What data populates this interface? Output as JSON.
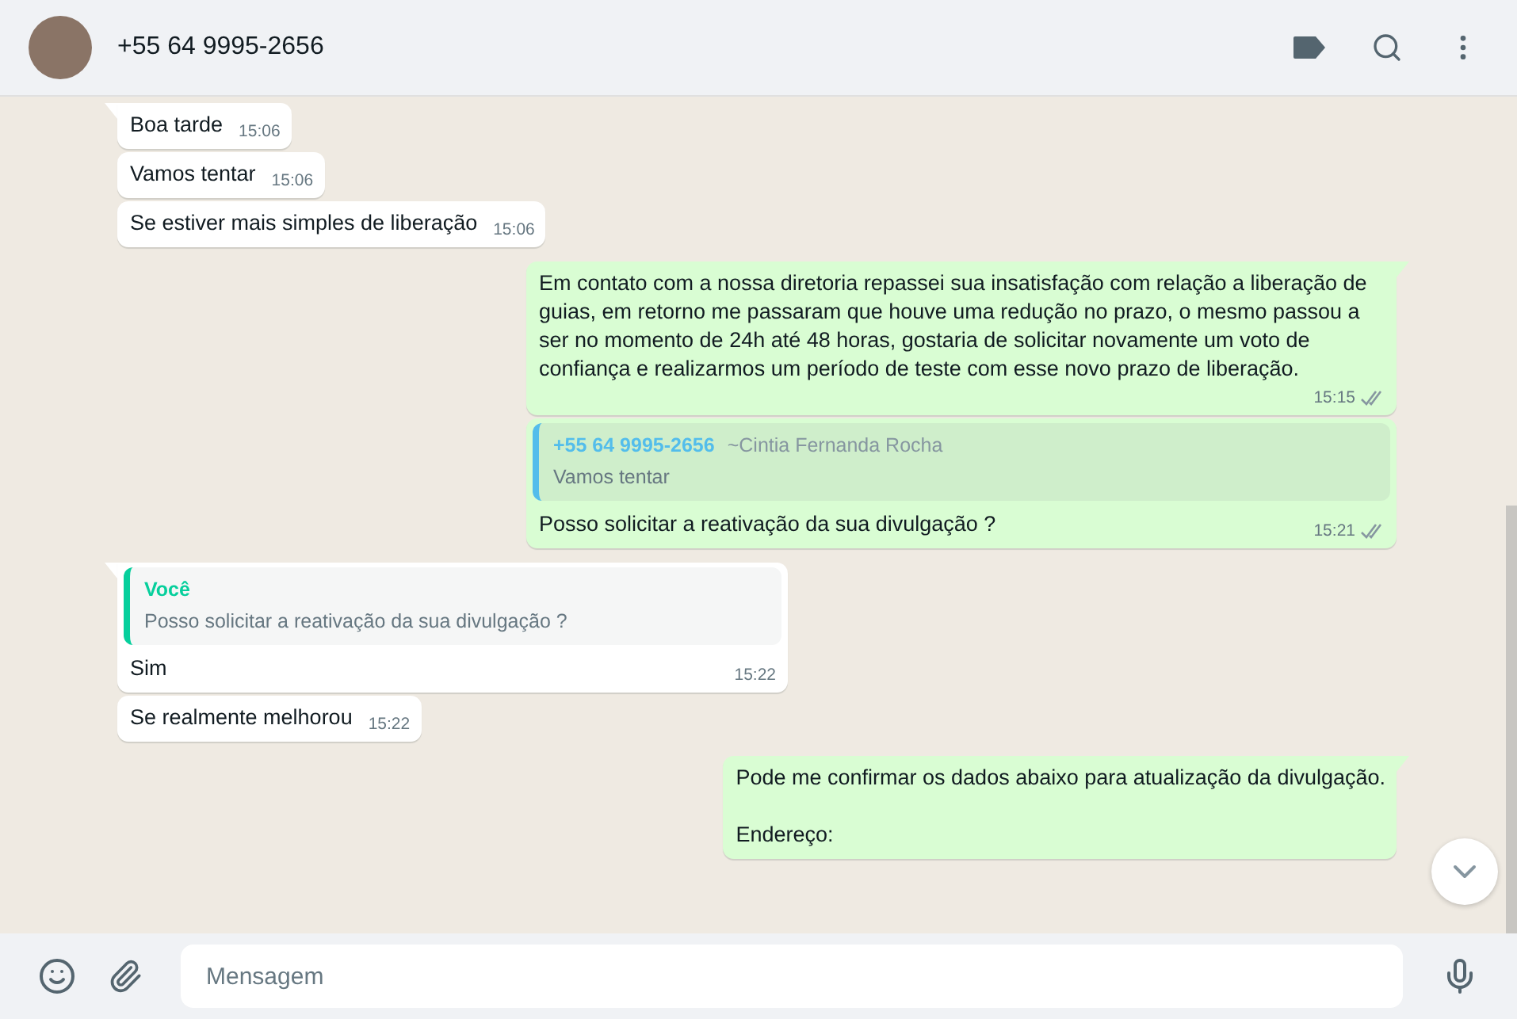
{
  "header": {
    "contact": "+55 64 9995-2656"
  },
  "messages": [
    {
      "kind": "incoming",
      "tail": true,
      "text": "Boa tarde",
      "time": "15:06"
    },
    {
      "kind": "incoming",
      "tail": false,
      "text": "Vamos tentar",
      "time": "15:06"
    },
    {
      "kind": "incoming",
      "tail": false,
      "text": "Se estiver mais simples de liberação",
      "time": "15:06"
    },
    {
      "kind": "outgoing",
      "tail": true,
      "text": "Em contato com a nossa diretoria repassei sua insatisfação com relação a liberação de guias, em retorno me passaram que houve uma redução no prazo, o mesmo passou a ser no momento de 24h até 48 horas, gostaria de solicitar novamente um voto de confiança e realizarmos um período de teste com esse novo prazo de liberação.",
      "time": "15:15",
      "read": false
    },
    {
      "kind": "outgoing",
      "tail": false,
      "quote": {
        "author": "+55 64 9995-2656",
        "alias": "~Cintia Fernanda Rocha",
        "text": "Vamos tentar",
        "color": "#53bdeb"
      },
      "text": "Posso solicitar a reativação da sua divulgação ?",
      "time": "15:21",
      "read": false
    },
    {
      "kind": "incoming",
      "tail": true,
      "quote": {
        "author": "Você",
        "text": "Posso solicitar a reativação da sua divulgação ?",
        "color": "#06cf9c"
      },
      "text": "Sim",
      "time": "15:22"
    },
    {
      "kind": "incoming",
      "tail": false,
      "text": "Se realmente melhorou",
      "time": "15:22"
    },
    {
      "kind": "outgoing",
      "tail": true,
      "paragraphs": [
        "Pode me confirmar os dados abaixo para atualização da divulgação.",
        "Endereço:"
      ]
    }
  ],
  "composer": {
    "placeholder": "Mensagem"
  }
}
